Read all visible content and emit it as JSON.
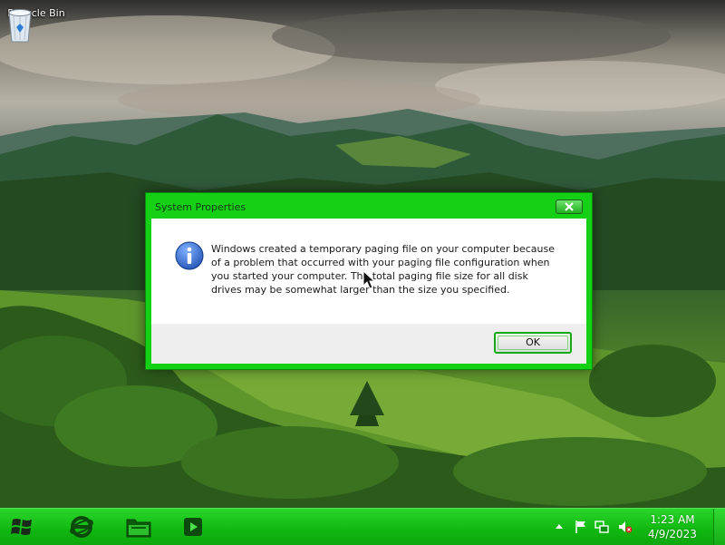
{
  "desktop": {
    "icons": [
      {
        "label": "Recycle Bin",
        "icon": "recycle-bin-icon"
      }
    ]
  },
  "dialog": {
    "title": "System Properties",
    "message": "Windows created a temporary paging file on your computer because of a problem that occurred with your paging file configuration when you started your computer.  The total paging file size for all disk drives may be somewhat larger than the size you specified.",
    "icon": "info-icon",
    "ok_label": "OK"
  },
  "taskbar": {
    "pinned": [
      "internet-explorer-icon",
      "windows-explorer-icon",
      "media-player-icon"
    ],
    "tray_icons": [
      "show-hidden-icons-chevron-icon",
      "action-center-flag-icon",
      "network-icon",
      "volume-muted-icon"
    ],
    "clock": {
      "time": "1:23 AM",
      "date": "4/9/2023"
    }
  },
  "colors": {
    "accent": "#15d115",
    "taskbar": "#10b710",
    "info": "#1f5bc4"
  }
}
